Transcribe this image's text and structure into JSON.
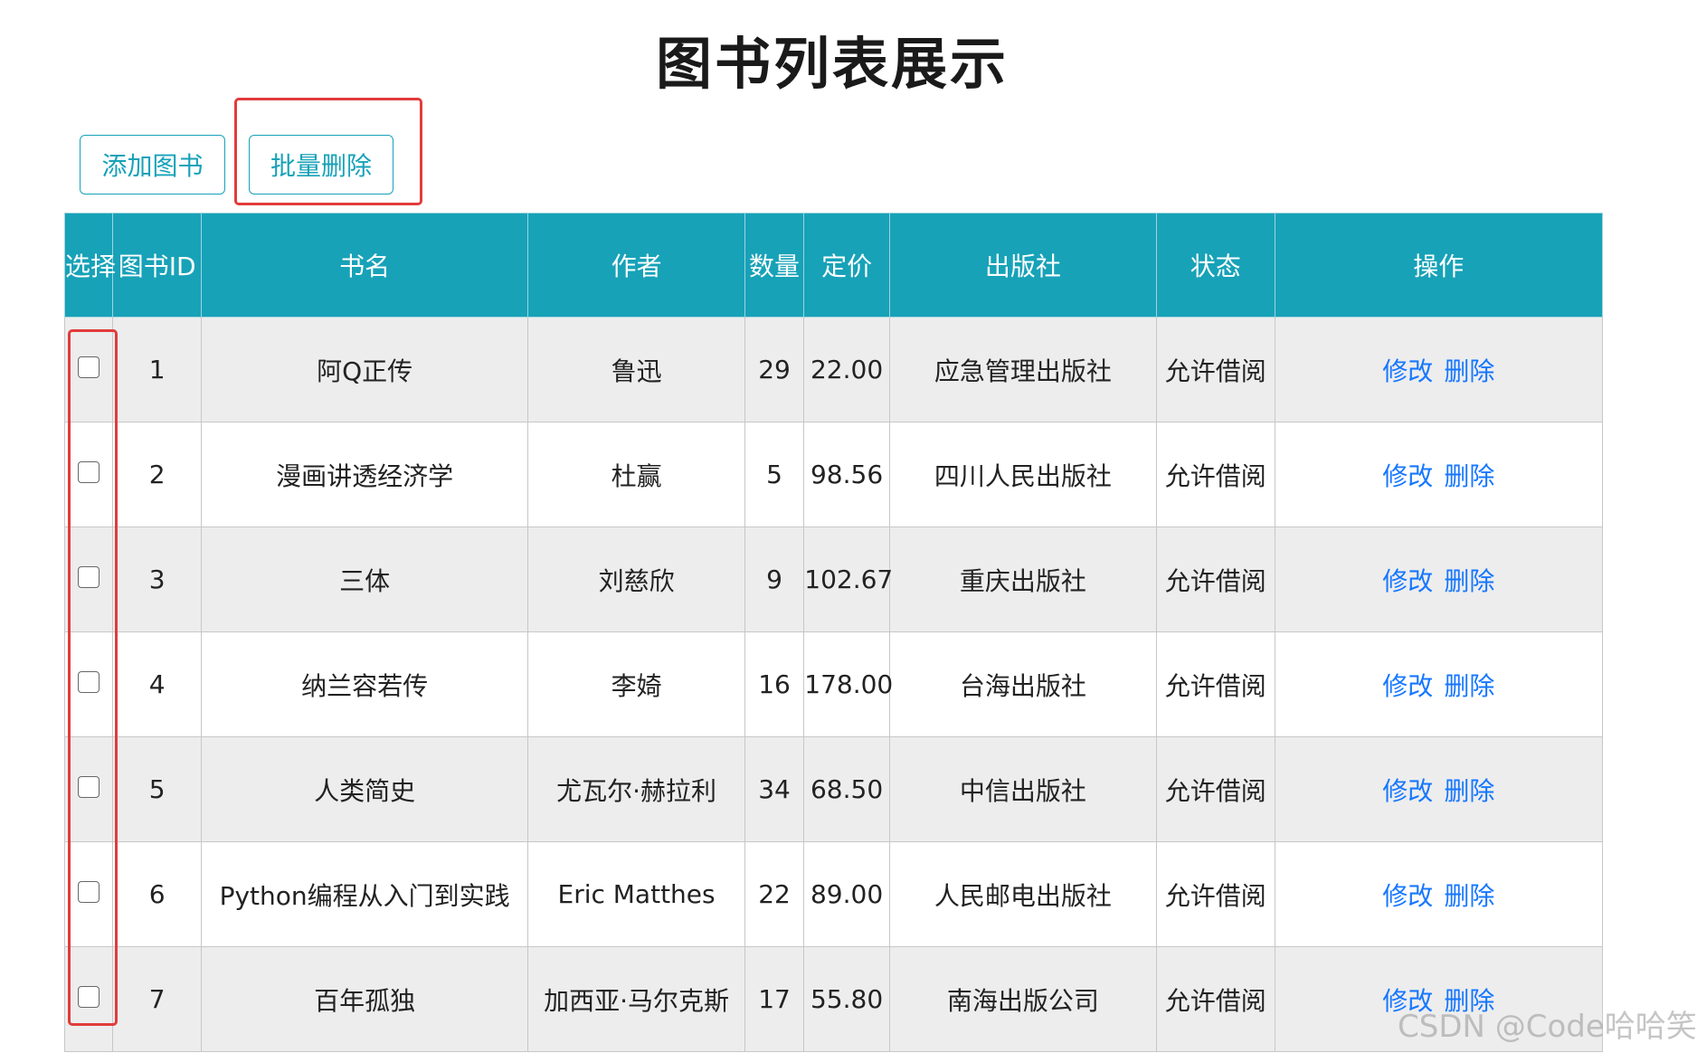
{
  "page": {
    "title": "图书列表展示"
  },
  "toolbar": {
    "add_label": "添加图书",
    "batch_delete_label": "批量删除"
  },
  "table": {
    "columns": [
      "选择",
      "图书ID",
      "书名",
      "作者",
      "数量",
      "定价",
      "出版社",
      "状态",
      "操作"
    ],
    "rows": [
      {
        "id": "1",
        "name": "阿Q正传",
        "author": "鲁迅",
        "count": "29",
        "price": "22.00",
        "publisher": "应急管理出版社",
        "status": "允许借阅",
        "edit": "修改",
        "delete": "删除"
      },
      {
        "id": "2",
        "name": "漫画讲透经济学",
        "author": "杜赢",
        "count": "5",
        "price": "98.56",
        "publisher": "四川人民出版社",
        "status": "允许借阅",
        "edit": "修改",
        "delete": "删除"
      },
      {
        "id": "3",
        "name": "三体",
        "author": "刘慈欣",
        "count": "9",
        "price": "102.67",
        "publisher": "重庆出版社",
        "status": "允许借阅",
        "edit": "修改",
        "delete": "删除"
      },
      {
        "id": "4",
        "name": "纳兰容若传",
        "author": "李婍",
        "count": "16",
        "price": "178.00",
        "publisher": "台海出版社",
        "status": "允许借阅",
        "edit": "修改",
        "delete": "删除"
      },
      {
        "id": "5",
        "name": "人类简史",
        "author": "尤瓦尔·赫拉利",
        "count": "34",
        "price": "68.50",
        "publisher": "中信出版社",
        "status": "允许借阅",
        "edit": "修改",
        "delete": "删除"
      },
      {
        "id": "6",
        "name": "Python编程从入门到实践",
        "author": "Eric Matthes",
        "count": "22",
        "price": "89.00",
        "publisher": "人民邮电出版社",
        "status": "允许借阅",
        "edit": "修改",
        "delete": "删除"
      },
      {
        "id": "7",
        "name": "百年孤独",
        "author": "加西亚·马尔克斯",
        "count": "17",
        "price": "55.80",
        "publisher": "南海出版公司",
        "status": "允许借阅",
        "edit": "修改",
        "delete": "删除"
      }
    ]
  },
  "watermark": "CSDN @Code哈哈笑",
  "colors": {
    "header_bg": "#17a2b8",
    "button_border": "#17a2b8",
    "link": "#1677ff",
    "highlight_box": "#e23b3b",
    "row_alt": "#ededed"
  }
}
